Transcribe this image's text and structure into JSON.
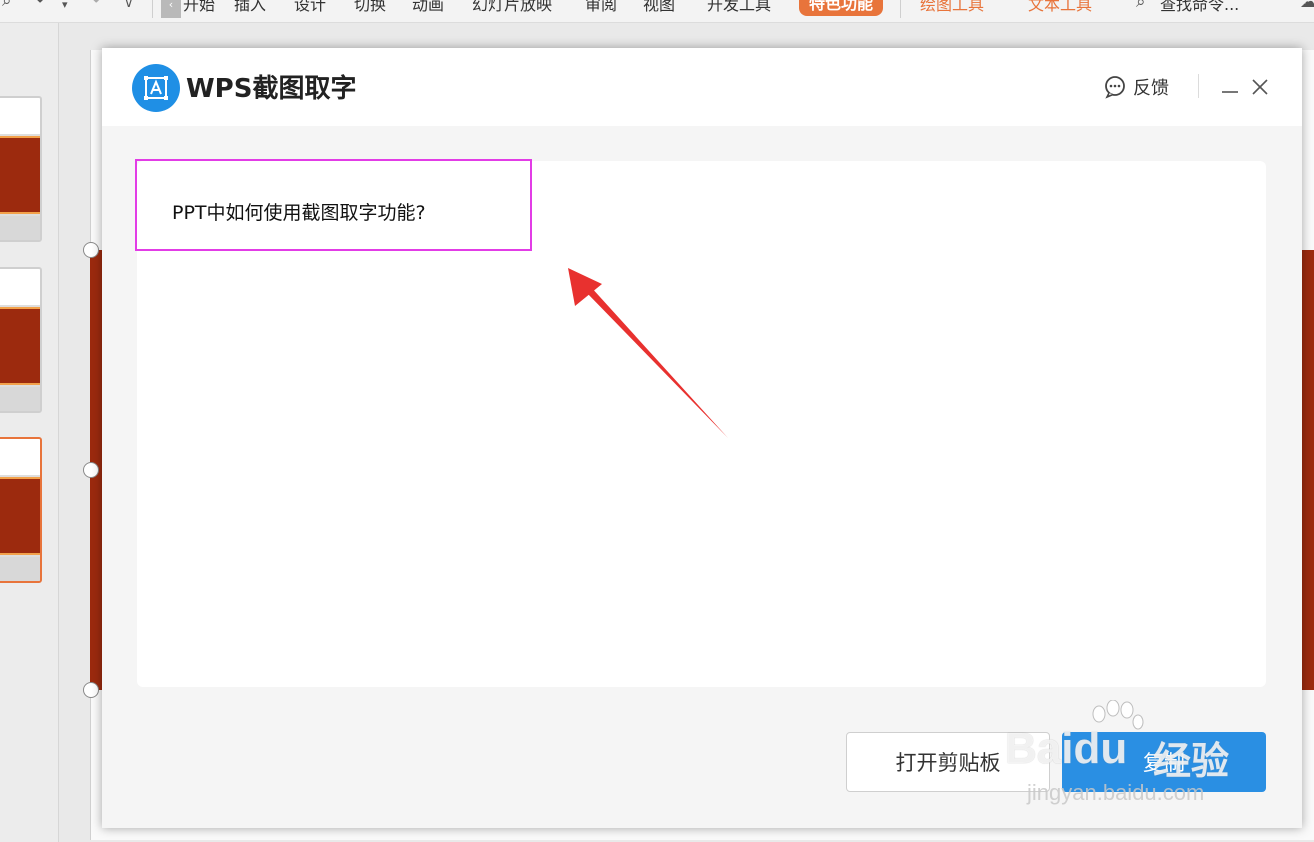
{
  "ribbon": {
    "tabs": [
      "开始",
      "插入",
      "设计",
      "切换",
      "动画",
      "幻灯片放映",
      "审阅",
      "视图",
      "开发工具"
    ],
    "special_tab": "特色功能",
    "context_tabs": [
      "绘图工具",
      "文本工具"
    ],
    "search_label": "查找命令..."
  },
  "dialog": {
    "title": "WPS截图取字",
    "feedback_label": "反馈",
    "ocr_text": "PPT中如何使用截图取字功能?",
    "open_clipboard_label": "打开剪贴板",
    "copy_label": "复制"
  },
  "watermark": {
    "brand": "Baidu",
    "cn": "经验",
    "url": "jingyan.baidu.com"
  },
  "colors": {
    "accent_blue": "#2a8fe3",
    "logo_blue": "#1f8fe5",
    "highlight_magenta": "#e23ce6",
    "arrow_red": "#e8312f",
    "tab_orange": "#e8743b",
    "slide_red": "#9c2a0e"
  }
}
